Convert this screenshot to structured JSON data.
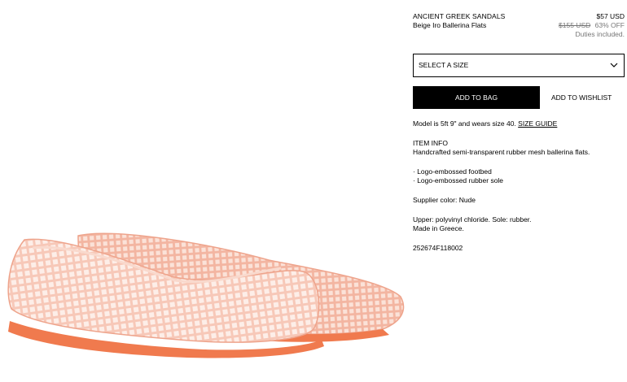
{
  "product": {
    "brand": "ANCIENT GREEK SANDALS",
    "name": "Beige Iro Ballerina Flats",
    "price": "$57 USD",
    "original_price": "$155 USD",
    "discount": "63% OFF",
    "duties": "Duties included."
  },
  "size_select": {
    "label": "SELECT A SIZE",
    "icon": "chevron-down-icon"
  },
  "actions": {
    "add_to_bag": "ADD TO BAG",
    "add_to_wishlist": "ADD TO WISHLIST"
  },
  "model_info": {
    "text": "Model is 5ft 9\" and wears size 40. ",
    "size_guide": "SIZE GUIDE"
  },
  "item_info": {
    "heading": "ITEM INFO",
    "description": "Handcrafted semi-transparent rubber mesh ballerina flats.",
    "features": [
      "· Logo-embossed footbed",
      "· Logo-embossed rubber sole"
    ],
    "supplier_color": "Supplier color: Nude",
    "material": "Upper: polyvinyl chloride. Sole: rubber.",
    "origin": "Made in Greece.",
    "sku": "252674F118002"
  },
  "colors": {
    "shoe_body": "#f4b9a6",
    "shoe_sole": "#f07a4e",
    "button_bg": "#000000"
  }
}
